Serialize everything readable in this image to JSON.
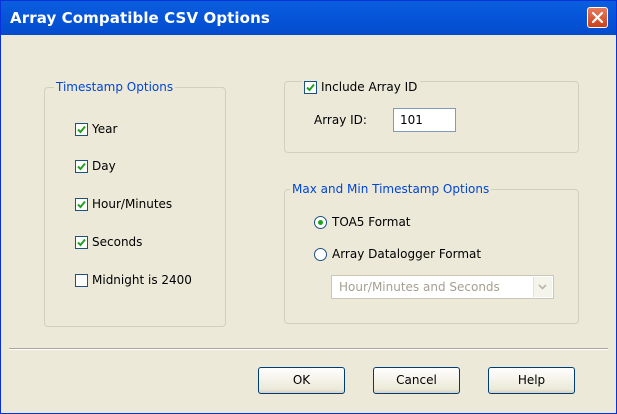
{
  "window": {
    "title": "Array Compatible CSV Options"
  },
  "timestamp_options": {
    "label": "Timestamp Options",
    "items": [
      {
        "label": "Year",
        "checked": true
      },
      {
        "label": "Day",
        "checked": true
      },
      {
        "label": "Hour/Minutes",
        "checked": true
      },
      {
        "label": "Seconds",
        "checked": true
      },
      {
        "label": "Midnight is 2400",
        "checked": false
      }
    ]
  },
  "array_id": {
    "checkbox_label": "Include Array ID",
    "checked": true,
    "field_label": "Array ID:",
    "value": "101"
  },
  "max_min": {
    "label": "Max and Min Timestamp Options",
    "options": [
      {
        "label": "TOA5 Format",
        "selected": true
      },
      {
        "label": "Array Datalogger Format",
        "selected": false
      }
    ],
    "dropdown_value": "Hour/Minutes and Seconds"
  },
  "buttons": {
    "ok": "OK",
    "cancel": "Cancel",
    "help": "Help"
  },
  "colors": {
    "group_label": "#0046d5",
    "titlebar": "#0654d8",
    "close": "#c9401b"
  }
}
